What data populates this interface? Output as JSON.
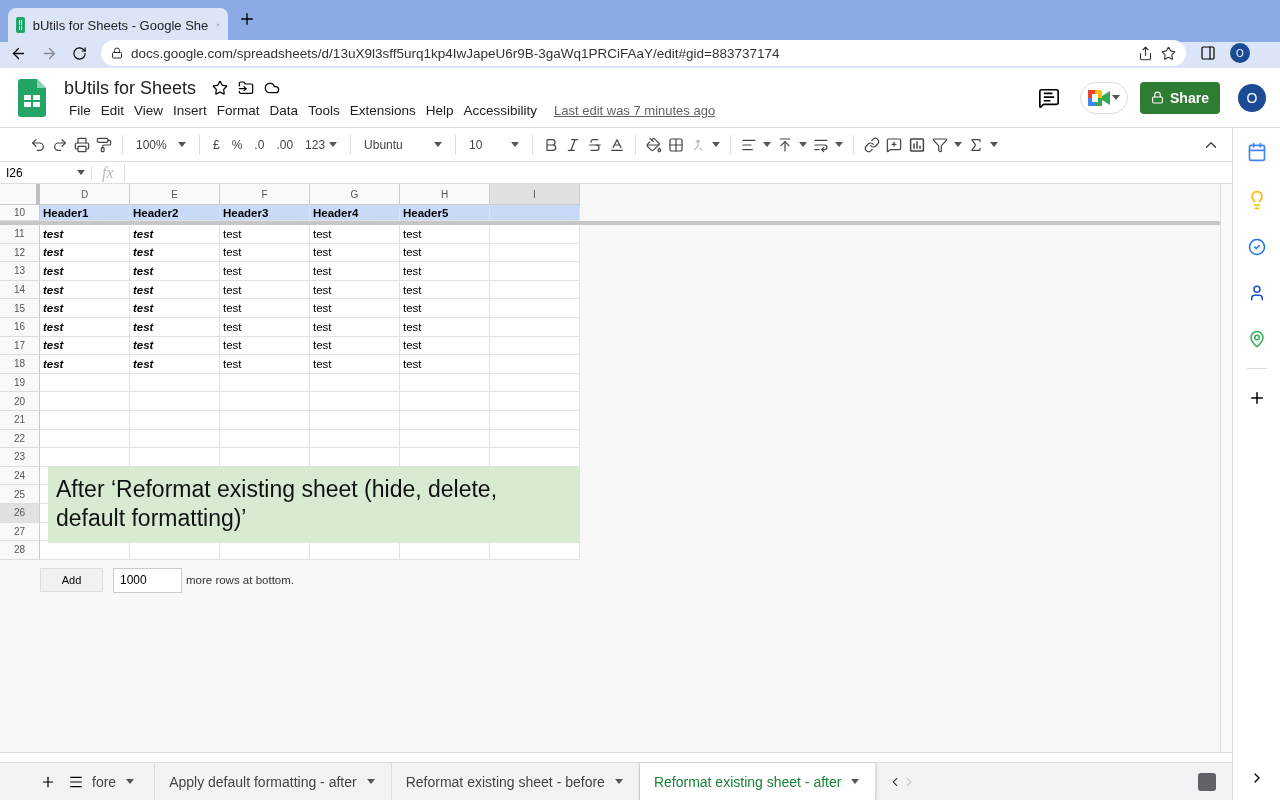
{
  "browser": {
    "tab_title": "bUtils for Sheets - Google She",
    "url": "docs.google.com/spreadsheets/d/13uX9l3sff5urq1kp4IwJapeU6r9B-3gaWq1PRCiFAaY/edit#gid=883737174",
    "profile": "O"
  },
  "doc": {
    "title": "bUtils for Sheets",
    "menu": [
      "File",
      "Edit",
      "View",
      "Insert",
      "Format",
      "Data",
      "Tools",
      "Extensions",
      "Help",
      "Accessibility"
    ],
    "last_edit": "Last edit was 7 minutes ago",
    "share": "Share",
    "avatar": "O"
  },
  "toolbar": {
    "zoom": "100%",
    "currency": "£",
    "percent": "%",
    "decrease_decimals": ".0",
    "increase_decimals": ".00",
    "number_format": "123",
    "font": "Ubuntu",
    "font_size": "10"
  },
  "formula_bar": {
    "name_box": "I26",
    "fx": "fx"
  },
  "columns": [
    {
      "letter": "D",
      "selected": false
    },
    {
      "letter": "E",
      "selected": false
    },
    {
      "letter": "F",
      "selected": false
    },
    {
      "letter": "G",
      "selected": false
    },
    {
      "letter": "H",
      "selected": false
    },
    {
      "letter": "I",
      "selected": true
    }
  ],
  "rows": [
    {
      "number": "10",
      "kind": "header",
      "selected": false,
      "cells": [
        {
          "text": "Header1",
          "bold": true,
          "italic": false
        },
        {
          "text": "Header2",
          "bold": true,
          "italic": false
        },
        {
          "text": "Header3",
          "bold": true,
          "italic": false
        },
        {
          "text": "Header4",
          "bold": true,
          "italic": false
        },
        {
          "text": "Header5",
          "bold": true,
          "italic": false
        }
      ]
    },
    {
      "number": "11",
      "kind": "data",
      "selected": false,
      "cells": [
        {
          "text": "test",
          "bold": true,
          "italic": true
        },
        {
          "text": "test",
          "bold": true,
          "italic": true
        },
        {
          "text": "test",
          "bold": false,
          "italic": false
        },
        {
          "text": "test",
          "bold": false,
          "italic": false
        },
        {
          "text": "test",
          "bold": false,
          "italic": false
        }
      ]
    },
    {
      "number": "12",
      "kind": "data",
      "selected": false,
      "cells": [
        {
          "text": "test",
          "bold": true,
          "italic": true
        },
        {
          "text": "test",
          "bold": true,
          "italic": true
        },
        {
          "text": "test",
          "bold": false,
          "italic": false
        },
        {
          "text": "test",
          "bold": false,
          "italic": false
        },
        {
          "text": "test",
          "bold": false,
          "italic": false
        }
      ]
    },
    {
      "number": "13",
      "kind": "data",
      "selected": false,
      "cells": [
        {
          "text": "test",
          "bold": true,
          "italic": true
        },
        {
          "text": "test",
          "bold": true,
          "italic": true
        },
        {
          "text": "test",
          "bold": false,
          "italic": false
        },
        {
          "text": "test",
          "bold": false,
          "italic": false
        },
        {
          "text": "test",
          "bold": false,
          "italic": false
        }
      ]
    },
    {
      "number": "14",
      "kind": "data",
      "selected": false,
      "cells": [
        {
          "text": "test",
          "bold": true,
          "italic": true
        },
        {
          "text": "test",
          "bold": true,
          "italic": true
        },
        {
          "text": "test",
          "bold": false,
          "italic": false
        },
        {
          "text": "test",
          "bold": false,
          "italic": false
        },
        {
          "text": "test",
          "bold": false,
          "italic": false
        }
      ]
    },
    {
      "number": "15",
      "kind": "data",
      "selected": false,
      "cells": [
        {
          "text": "test",
          "bold": true,
          "italic": true
        },
        {
          "text": "test",
          "bold": true,
          "italic": true
        },
        {
          "text": "test",
          "bold": false,
          "italic": false
        },
        {
          "text": "test",
          "bold": false,
          "italic": false
        },
        {
          "text": "test",
          "bold": false,
          "italic": false
        }
      ]
    },
    {
      "number": "16",
      "kind": "data",
      "selected": false,
      "cells": [
        {
          "text": "test",
          "bold": true,
          "italic": true
        },
        {
          "text": "test",
          "bold": true,
          "italic": true
        },
        {
          "text": "test",
          "bold": false,
          "italic": false
        },
        {
          "text": "test",
          "bold": false,
          "italic": false
        },
        {
          "text": "test",
          "bold": false,
          "italic": false
        }
      ]
    },
    {
      "number": "17",
      "kind": "data",
      "selected": false,
      "cells": [
        {
          "text": "test",
          "bold": true,
          "italic": true
        },
        {
          "text": "test",
          "bold": true,
          "italic": true
        },
        {
          "text": "test",
          "bold": false,
          "italic": false
        },
        {
          "text": "test",
          "bold": false,
          "italic": false
        },
        {
          "text": "test",
          "bold": false,
          "italic": false
        }
      ]
    },
    {
      "number": "18",
      "kind": "data",
      "selected": false,
      "cells": [
        {
          "text": "test",
          "bold": true,
          "italic": true
        },
        {
          "text": "test",
          "bold": true,
          "italic": true
        },
        {
          "text": "test",
          "bold": false,
          "italic": false
        },
        {
          "text": "test",
          "bold": false,
          "italic": false
        },
        {
          "text": "test",
          "bold": false,
          "italic": false
        }
      ]
    },
    {
      "number": "19",
      "kind": "data",
      "selected": false
    },
    {
      "number": "20",
      "kind": "data",
      "selected": false
    },
    {
      "number": "21",
      "kind": "data",
      "selected": false
    },
    {
      "number": "22",
      "kind": "data",
      "selected": false
    },
    {
      "number": "23",
      "kind": "data",
      "selected": false
    },
    {
      "number": "24",
      "kind": "data",
      "selected": false
    },
    {
      "number": "25",
      "kind": "data",
      "selected": false
    },
    {
      "number": "26",
      "kind": "data",
      "selected": true
    },
    {
      "number": "27",
      "kind": "data",
      "selected": false
    },
    {
      "number": "28",
      "kind": "data",
      "selected": false
    }
  ],
  "note": "After ‘Reformat existing sheet (hide, delete, default formatting)’",
  "add_rows": {
    "button": "Add",
    "value": "1000",
    "suffix": "more rows at bottom."
  },
  "sheet_tabs": [
    {
      "label": "fore",
      "selected": false
    },
    {
      "label": "Apply default formatting - after",
      "selected": false
    },
    {
      "label": "Reformat existing sheet - before",
      "selected": false
    },
    {
      "label": "Reformat existing sheet - after",
      "selected": true
    }
  ]
}
